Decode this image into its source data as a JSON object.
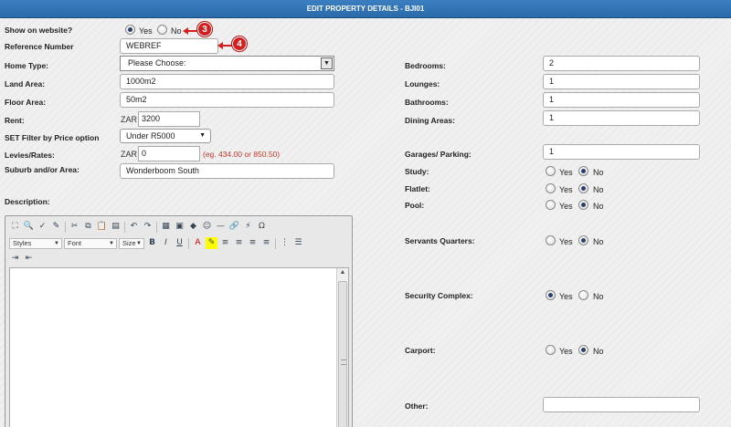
{
  "header": {
    "title": "EDIT PROPERTY DETAILS - BJI01"
  },
  "left": {
    "show_on_website": {
      "label": "Show on website?",
      "yes": "Yes",
      "no": "No",
      "selected": "Yes"
    },
    "reference_number": {
      "label": "Reference Number",
      "value": "WEBREF"
    },
    "home_type": {
      "label": "Home Type:",
      "value": "Please Choose:"
    },
    "land_area": {
      "label": "Land Area:",
      "value": "1000m2"
    },
    "floor_area": {
      "label": "Floor Area:",
      "value": "50m2"
    },
    "rent": {
      "label": "Rent:",
      "currency": "ZAR",
      "value": "3200"
    },
    "price_filter": {
      "label": "SET Filter by Price option",
      "value": "Under R5000"
    },
    "levies": {
      "label": "Levies/Rates:",
      "currency": "ZAR",
      "value": "0",
      "hint": "(eg. 434.00 or 850.50)"
    },
    "suburb": {
      "label": "Suburb and/or Area:",
      "value": "Wonderboom South"
    },
    "description": {
      "label": "Description:"
    }
  },
  "editor": {
    "styles": "Styles",
    "font": "Font",
    "size": "Size",
    "bold": "B",
    "italic": "I",
    "underline": "U"
  },
  "right": {
    "bedrooms": {
      "label": "Bedrooms:",
      "value": "2"
    },
    "lounges": {
      "label": "Lounges:",
      "value": "1"
    },
    "bathrooms": {
      "label": "Bathrooms:",
      "value": "1"
    },
    "dining": {
      "label": "Dining Areas:",
      "value": "1"
    },
    "garages": {
      "label": "Garages/ Parking:",
      "value": "1"
    },
    "study": {
      "label": "Study:",
      "selected": "No"
    },
    "flatlet": {
      "label": "Flatlet:",
      "selected": "No"
    },
    "pool": {
      "label": "Pool:",
      "selected": "No"
    },
    "servants": {
      "label": "Servants Quarters:",
      "selected": "No"
    },
    "security": {
      "label": "Security Complex:",
      "selected": "Yes"
    },
    "carport": {
      "label": "Carport:",
      "selected": "No"
    },
    "other": {
      "label": "Other:",
      "value": ""
    },
    "yes_label": "Yes",
    "no_label": "No"
  },
  "callouts": {
    "three": "3",
    "four": "4"
  },
  "colors": {
    "header": "#2f74b5",
    "callout": "#d21f1f",
    "hint": "#c0392b"
  }
}
